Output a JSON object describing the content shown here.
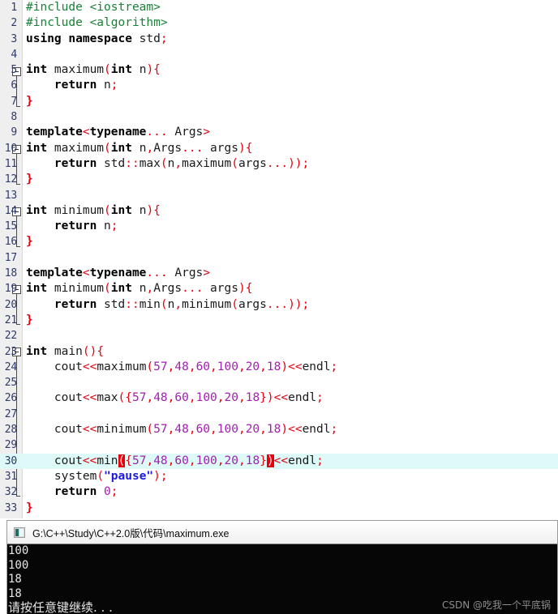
{
  "editor": {
    "name": "code-editor",
    "language": "C++",
    "line_count": 33,
    "highlighted_line": 30,
    "colors": {
      "background": "#ffffff",
      "gutter": "#efefef",
      "line_number": "#2b3a6b",
      "preprocessor": "#1a7f37",
      "keyword": "#000000",
      "punctuation": "#e8000d",
      "number": "#a020b0",
      "string": "#1a1ae0",
      "current_line": "#ddfaf8",
      "bracket_match": "#e8000d"
    },
    "lines": [
      {
        "n": "1",
        "text": "#include <iostream>"
      },
      {
        "n": "2",
        "text": "#include <algorithm>"
      },
      {
        "n": "3",
        "text": "using namespace std;"
      },
      {
        "n": "4",
        "text": ""
      },
      {
        "n": "5",
        "text": "int maximum(int n){"
      },
      {
        "n": "6",
        "text": "    return n;"
      },
      {
        "n": "7",
        "text": "}"
      },
      {
        "n": "8",
        "text": ""
      },
      {
        "n": "9",
        "text": "template<typename... Args>"
      },
      {
        "n": "10",
        "text": "int maximum(int n,Args... args){"
      },
      {
        "n": "11",
        "text": "    return std::max(n,maximum(args...));"
      },
      {
        "n": "12",
        "text": "}"
      },
      {
        "n": "13",
        "text": ""
      },
      {
        "n": "14",
        "text": "int minimum(int n){"
      },
      {
        "n": "15",
        "text": "    return n;"
      },
      {
        "n": "16",
        "text": "}"
      },
      {
        "n": "17",
        "text": ""
      },
      {
        "n": "18",
        "text": "template<typename... Args>"
      },
      {
        "n": "19",
        "text": "int minimum(int n,Args... args){"
      },
      {
        "n": "20",
        "text": "    return std::min(n,minimum(args...));"
      },
      {
        "n": "21",
        "text": "}"
      },
      {
        "n": "22",
        "text": ""
      },
      {
        "n": "23",
        "text": "int main(){"
      },
      {
        "n": "24",
        "text": "    cout<<maximum(57,48,60,100,20,18)<<endl;"
      },
      {
        "n": "25",
        "text": ""
      },
      {
        "n": "26",
        "text": "    cout<<max({57,48,60,100,20,18})<<endl;"
      },
      {
        "n": "27",
        "text": ""
      },
      {
        "n": "28",
        "text": "    cout<<minimum(57,48,60,100,20,18)<<endl;"
      },
      {
        "n": "29",
        "text": ""
      },
      {
        "n": "30",
        "text": "    cout<<min({57,48,60,100,20,18})<<endl;"
      },
      {
        "n": "31",
        "text": "    system(\"pause\");"
      },
      {
        "n": "32",
        "text": "    return 0;"
      },
      {
        "n": "33",
        "text": "}"
      }
    ]
  },
  "console": {
    "title": "G:\\C++\\Study\\C++2.0版\\代码\\maximum.exe",
    "icon": "console-app-icon",
    "output": [
      "100",
      "100",
      "18",
      "18"
    ],
    "prompt": "请按任意键继续. . ."
  },
  "watermark": "CSDN @吃我一个平底锅"
}
